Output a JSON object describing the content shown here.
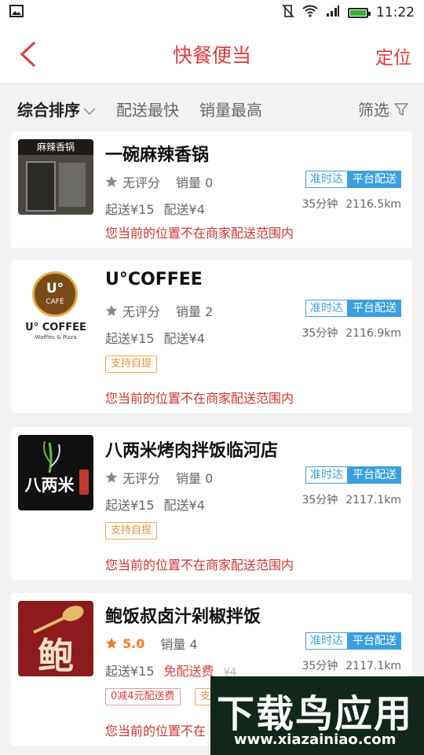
{
  "status_bar": {
    "time": "11:22"
  },
  "header": {
    "title": "快餐便当",
    "location_label": "定位"
  },
  "filters": {
    "sort": "综合排序",
    "fastest": "配送最快",
    "sales": "销量最高",
    "screen": "筛选"
  },
  "shops": [
    {
      "name": "一碗麻辣香锅",
      "logo_text": "麻辣香锅",
      "score": "无评分",
      "sales": "销量 0",
      "min_order": "起送¥15",
      "delivery_fee": "配送¥4",
      "badge_ontime": "准时达",
      "badge_platform": "平台配送",
      "time": "35分钟",
      "distance": "2116.5km",
      "warning": "您当前的位置不在商家配送范围内"
    },
    {
      "name": "U°COFFEE",
      "logo_text": "U° COFFEE",
      "logo_inner": "U°",
      "logo_cafe": "CAFÉ",
      "logo_sub": "Waffles & Pizza",
      "score": "无评分",
      "sales": "销量 2",
      "min_order": "起送¥15",
      "delivery_fee": "配送¥4",
      "badge_ontime": "准时达",
      "badge_platform": "平台配送",
      "time": "35分钟",
      "distance": "2116.9km",
      "tag": "支持自提",
      "warning": "您当前的位置不在商家配送范围内"
    },
    {
      "name": "八两米烤肉拌饭临河店",
      "logo_text": "八两米",
      "score": "无评分",
      "sales": "销量 0",
      "min_order": "起送¥15",
      "delivery_fee": "配送¥4",
      "badge_ontime": "准时达",
      "badge_platform": "平台配送",
      "time": "35分钟",
      "distance": "2117.1km",
      "tag": "支持自提",
      "warning": "您当前的位置不在商家配送范围内"
    },
    {
      "name": "鲍饭叔卤汁剁椒拌饭",
      "logo_text": "鲍",
      "score": "5.0",
      "sales": "销量 4",
      "min_order": "起送¥15",
      "delivery_fee": "免配送费",
      "old_fee": "¥4",
      "badge_ontime": "准时达",
      "badge_platform": "平台配送",
      "time": "35分钟",
      "distance": "2117.1km",
      "tag_discount": "0减4元配送费",
      "tag": "支",
      "warning": "您当前的位置不在"
    }
  ],
  "watermark": {
    "title": "下载鸟应用",
    "url": "www.xiazainiao.com"
  },
  "colors": {
    "accent": "#e23b3b",
    "blue": "#3a9fe0",
    "orange": "#f47b20"
  }
}
